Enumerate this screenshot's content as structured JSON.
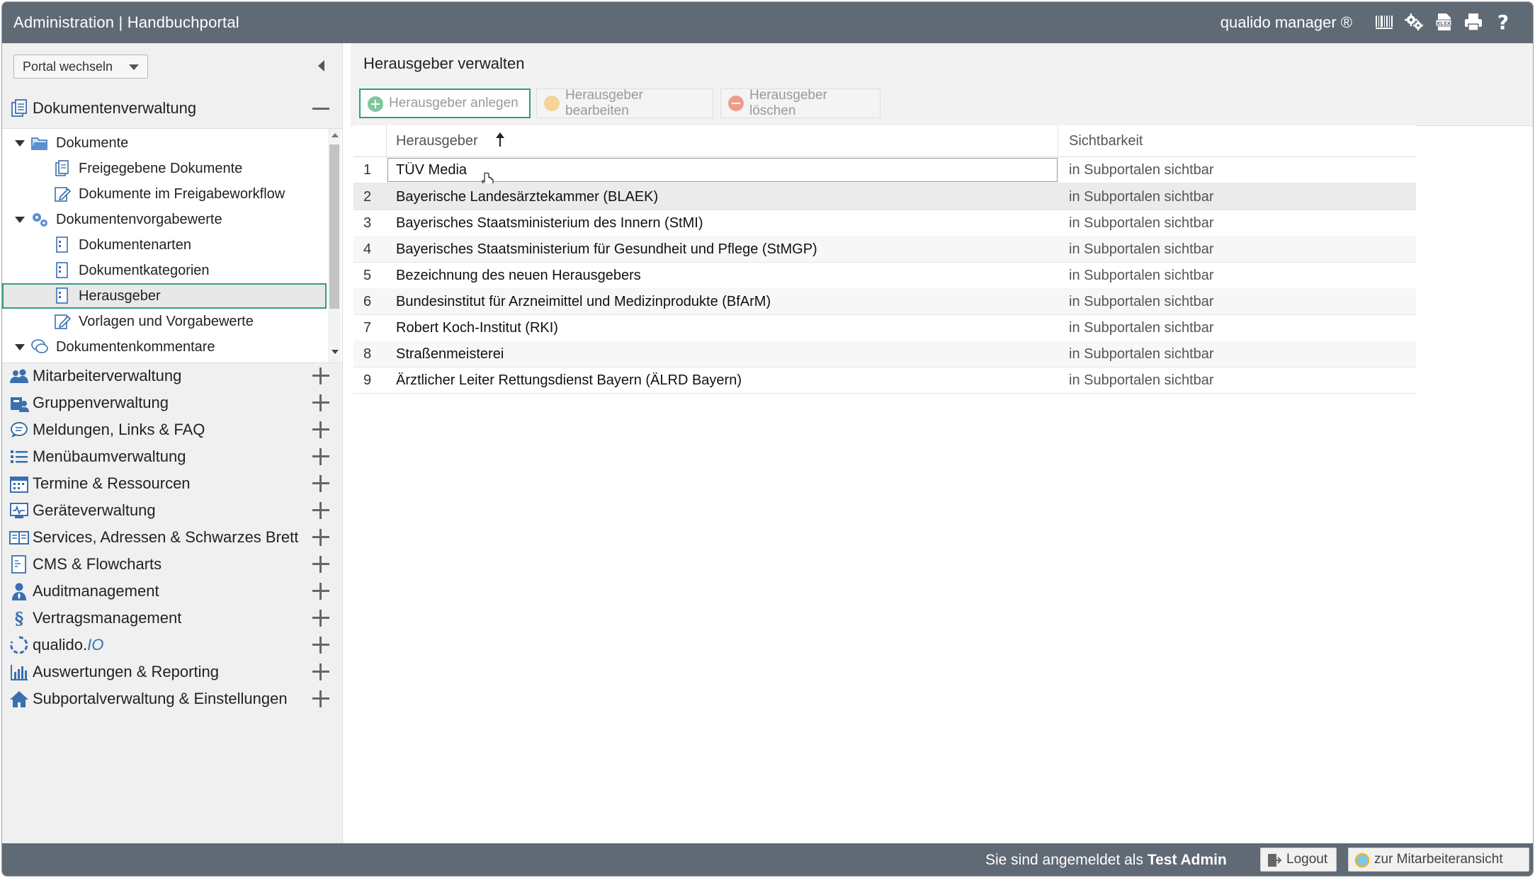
{
  "header": {
    "title": "Administration | Handbuchportal",
    "brand": "qualido manager ®",
    "icons": [
      "barcode-icon",
      "settings-gears-icon",
      "xlsx-export-icon",
      "print-icon",
      "help-icon"
    ]
  },
  "sidebar": {
    "portal_button": "Portal wechseln",
    "section_open": {
      "label": "Dokumentenverwaltung"
    },
    "tree": [
      {
        "label": "Dokumente",
        "level": 0,
        "expanded": true
      },
      {
        "label": "Freigegebene Dokumente",
        "level": 1
      },
      {
        "label": "Dokumente im Freigabeworkflow",
        "level": 1
      },
      {
        "label": "Dokumentenvorgabewerte",
        "level": 0,
        "expanded": true
      },
      {
        "label": "Dokumentenarten",
        "level": 1
      },
      {
        "label": "Dokumentkategorien",
        "level": 1
      },
      {
        "label": "Herausgeber",
        "level": 1,
        "selected": true
      },
      {
        "label": "Vorlagen und Vorgabewerte",
        "level": 1
      },
      {
        "label": "Dokumentenkommentare",
        "level": 0,
        "expanded": true
      }
    ],
    "sections": [
      {
        "label": "Mitarbeiterverwaltung"
      },
      {
        "label": "Gruppenverwaltung"
      },
      {
        "label": "Meldungen, Links & FAQ"
      },
      {
        "label": "Menübaumverwaltung"
      },
      {
        "label": "Termine & Ressourcen"
      },
      {
        "label": "Geräteverwaltung"
      },
      {
        "label": "Services, Adressen & Schwarzes Brett"
      },
      {
        "label": "CMS & Flowcharts"
      },
      {
        "label": "Auditmanagement"
      },
      {
        "label": "Vertragsmanagement"
      },
      {
        "label": "qualido.",
        "label_suffix": "IO"
      },
      {
        "label": "Auswertungen & Reporting"
      },
      {
        "label": "Subportalverwaltung & Einstellungen"
      }
    ]
  },
  "main": {
    "title": "Herausgeber verwalten",
    "toolbar": {
      "add": "Herausgeber anlegen",
      "edit": "Herausgeber bearbeiten",
      "delete": "Herausgeber löschen"
    },
    "table": {
      "columns": [
        "Herausgeber",
        "Sichtbarkeit"
      ],
      "rows": [
        {
          "n": "1",
          "name": "TÜV Media",
          "vis": "in Subportalen sichtbar"
        },
        {
          "n": "2",
          "name": "Bayerische Landesärztekammer (BLAEK)",
          "vis": "in Subportalen sichtbar"
        },
        {
          "n": "3",
          "name": "Bayerisches Staatsministerium des Innern (StMI)",
          "vis": "in Subportalen sichtbar"
        },
        {
          "n": "4",
          "name": "Bayerisches Staatsministerium für Gesundheit und Pflege (StMGP)",
          "vis": "in Subportalen sichtbar"
        },
        {
          "n": "5",
          "name": "Bezeichnung des neuen Herausgebers",
          "vis": "in Subportalen sichtbar"
        },
        {
          "n": "6",
          "name": "Bundesinstitut für Arzneimittel und Medizinprodukte (BfArM)",
          "vis": "in Subportalen sichtbar"
        },
        {
          "n": "7",
          "name": "Robert Koch-Institut (RKI)",
          "vis": "in Subportalen sichtbar"
        },
        {
          "n": "8",
          "name": "Straßenmeisterei",
          "vis": "in Subportalen sichtbar"
        },
        {
          "n": "9",
          "name": "Ärztlicher Leiter Rettungsdienst Bayern (ÄLRD Bayern)",
          "vis": "in Subportalen sichtbar"
        }
      ]
    }
  },
  "footer": {
    "logged_in_prefix": "Sie sind angemeldet als",
    "user": "Test Admin",
    "logout": "Logout",
    "employee_view": "zur Mitarbeiteransicht"
  },
  "colors": {
    "header_bg": "#606a75",
    "focus": "#2f9e86",
    "icon_blue": "#3a6fb0"
  }
}
